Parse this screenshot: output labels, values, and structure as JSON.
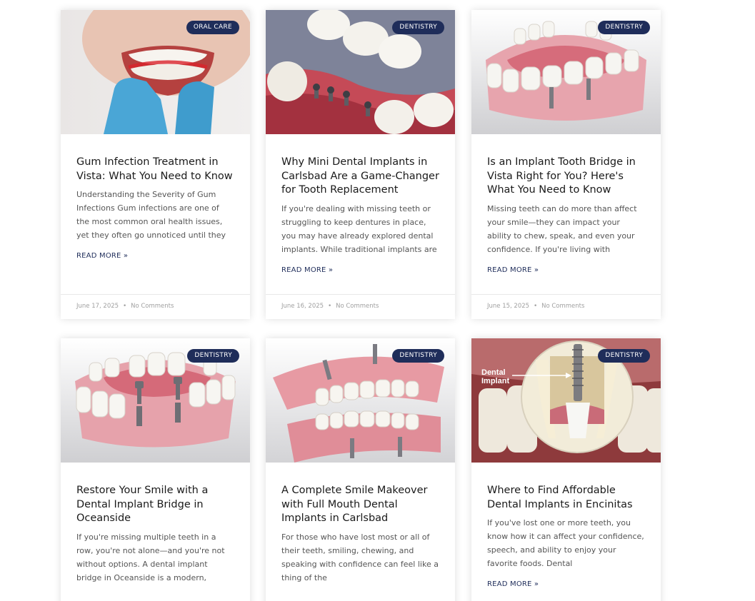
{
  "posts": [
    {
      "category": "ORAL CARE",
      "title": "Gum Infection Treatment in Vista: What You Need to Know",
      "excerpt": "Understanding the Severity of Gum Infections Gum infections are one of the most common oral health issues, yet they often go unnoticed until they",
      "read_more": "READ MORE »",
      "date": "June 17, 2025",
      "comments": "No Comments",
      "image": "gum-infection-photo"
    },
    {
      "category": "DENTISTRY",
      "title": "Why Mini Dental Implants in Carlsbad Are a Game-Changer for Tooth Replacement",
      "excerpt": "If you're dealing with missing teeth or struggling to keep dentures in place, you may have already explored dental implants. While traditional implants are",
      "read_more": "READ MORE »",
      "date": "June 16, 2025",
      "comments": "No Comments",
      "image": "mini-implants-render"
    },
    {
      "category": "DENTISTRY",
      "title": "Is an Implant Tooth Bridge in Vista Right for You? Here's What You Need to Know",
      "excerpt": "Missing teeth can do more than affect your smile—they can impact your ability to chew, speak, and even your confidence. If you're living with",
      "read_more": "READ MORE »",
      "date": "June 15, 2025",
      "comments": "No Comments",
      "image": "implant-bridge-render"
    },
    {
      "category": "DENTISTRY",
      "title": "Restore Your Smile with a Dental Implant Bridge in Oceanside",
      "excerpt": "If you're missing multiple teeth in a row, you're not alone—and you're not without options. A dental implant bridge in Oceanside is a modern,",
      "read_more": "",
      "date": "",
      "comments": "",
      "image": "implant-bridge-abutments"
    },
    {
      "category": "DENTISTRY",
      "title": "A Complete Smile Makeover with Full Mouth Dental Implants in Carlsbad",
      "excerpt": "For those who have lost most or all of their teeth, smiling, chewing, and speaking with confidence can feel like a thing of the",
      "read_more": "",
      "date": "",
      "comments": "",
      "image": "full-mouth-implants"
    },
    {
      "category": "DENTISTRY",
      "title": "Where to Find Affordable Dental Implants in Encinitas",
      "excerpt": "If you've lost one or more teeth, you know how it can affect your confidence, speech, and ability to enjoy your favorite foods. Dental",
      "read_more": "READ MORE »",
      "date": "",
      "comments": "",
      "image": "dental-implant-cross-section",
      "image_label": "Dental Implant"
    }
  ]
}
